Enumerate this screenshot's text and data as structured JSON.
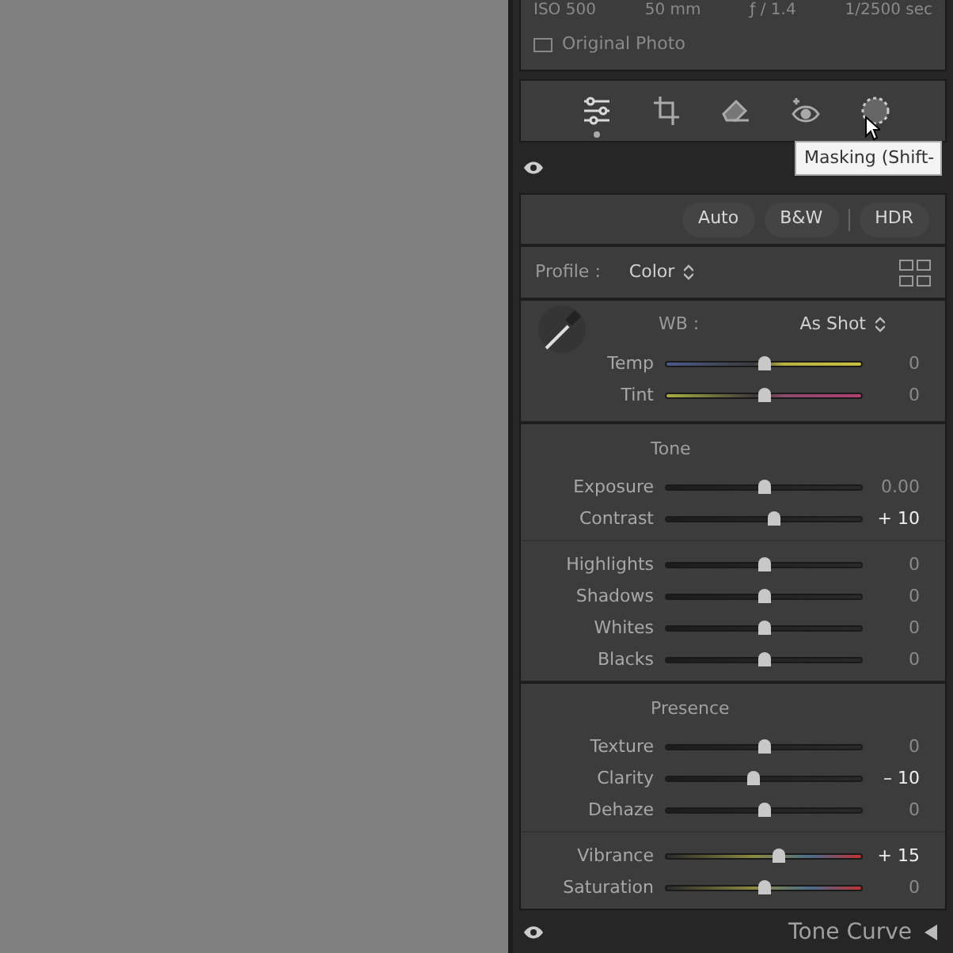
{
  "exif": [
    "ISO 500",
    "50 mm",
    "ƒ / 1.4",
    "1/2500 sec"
  ],
  "original_photo": {
    "label": "Original Photo",
    "checked": false
  },
  "tools": [
    {
      "kind": "edit",
      "selected": true
    },
    {
      "kind": "crop",
      "selected": false
    },
    {
      "kind": "heal",
      "selected": false
    },
    {
      "kind": "redeye",
      "selected": false
    },
    {
      "kind": "mask",
      "selected": false
    }
  ],
  "tooltip": "Masking (Shift-",
  "treatment_buttons": [
    "Auto",
    "B&W",
    "HDR"
  ],
  "profile": {
    "label": "Profile :",
    "value": "Color"
  },
  "wb": {
    "label": "WB :",
    "value": "As Shot"
  },
  "wb_sliders": [
    {
      "label": "Temp",
      "kind": "temp",
      "level": 0.5,
      "reading": "0",
      "modified": false
    },
    {
      "label": "Tint",
      "kind": "tint",
      "level": 0.5,
      "reading": "0",
      "modified": false
    }
  ],
  "sections": [
    {
      "title": "Tone",
      "groups": [
        [
          {
            "label": "Exposure",
            "kind": "plain",
            "level": 0.5,
            "reading": "0.00",
            "modified": false
          },
          {
            "label": "Contrast",
            "kind": "plain",
            "level": 0.55,
            "reading": "+ 10",
            "modified": true
          }
        ],
        [
          {
            "label": "Highlights",
            "kind": "plain",
            "level": 0.5,
            "reading": "0",
            "modified": false
          },
          {
            "label": "Shadows",
            "kind": "plain",
            "level": 0.5,
            "reading": "0",
            "modified": false
          },
          {
            "label": "Whites",
            "kind": "plain",
            "level": 0.5,
            "reading": "0",
            "modified": false
          },
          {
            "label": "Blacks",
            "kind": "plain",
            "level": 0.5,
            "reading": "0",
            "modified": false
          }
        ]
      ]
    },
    {
      "title": "Presence",
      "groups": [
        [
          {
            "label": "Texture",
            "kind": "plain",
            "level": 0.5,
            "reading": "0",
            "modified": false
          },
          {
            "label": "Clarity",
            "kind": "plain",
            "level": 0.45,
            "reading": "– 10",
            "modified": true
          },
          {
            "label": "Dehaze",
            "kind": "plain",
            "level": 0.5,
            "reading": "0",
            "modified": false
          }
        ],
        [
          {
            "label": "Vibrance",
            "kind": "color",
            "level": 0.575,
            "reading": "+ 15",
            "modified": true
          },
          {
            "label": "Saturation",
            "kind": "color",
            "level": 0.5,
            "reading": "0",
            "modified": false
          }
        ]
      ]
    }
  ],
  "next_panel": {
    "title": "Tone Curve"
  }
}
